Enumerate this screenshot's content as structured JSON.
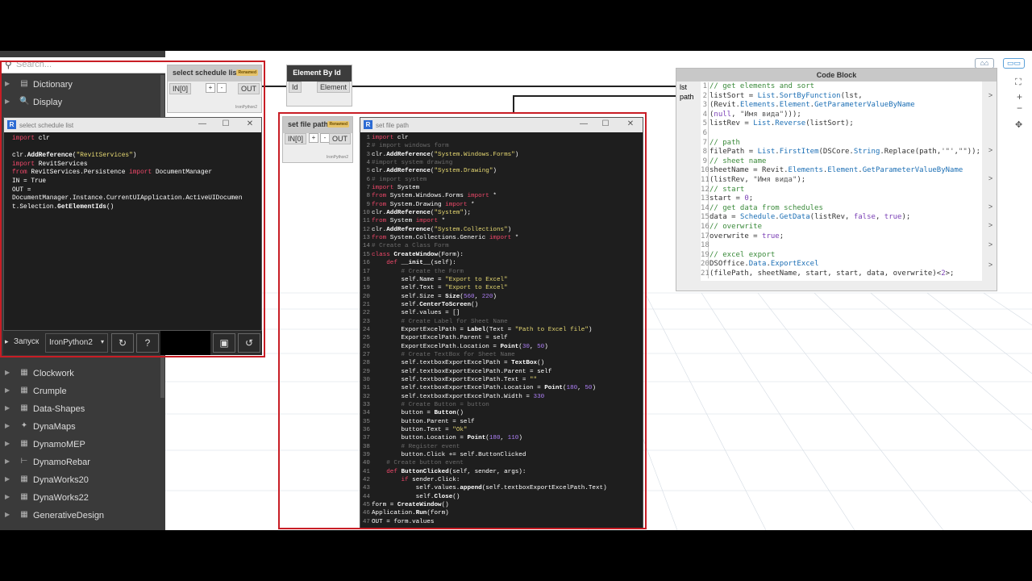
{
  "library": {
    "search_placeholder": "Search...",
    "items": [
      {
        "label": "Dictionary",
        "icon": "dictionary-icon",
        "glyph": "▤"
      },
      {
        "label": "Display",
        "icon": "display-icon",
        "glyph": "🔍"
      },
      {
        "label": "Clockwork",
        "icon": "package-icon",
        "glyph": "▦"
      },
      {
        "label": "Crumple",
        "icon": "package-icon",
        "glyph": "▦"
      },
      {
        "label": "Data-Shapes",
        "icon": "package-icon",
        "glyph": "▦"
      },
      {
        "label": "DynaMaps",
        "icon": "dynamaps-icon",
        "glyph": "✦"
      },
      {
        "label": "DynamoMEP",
        "icon": "package-icon",
        "glyph": "▦"
      },
      {
        "label": "DynamoRebar",
        "icon": "rebar-icon",
        "glyph": "⊢"
      },
      {
        "label": "DynaWorks20",
        "icon": "package-icon",
        "glyph": "▦"
      },
      {
        "label": "DynaWorks22",
        "icon": "package-icon",
        "glyph": "▦"
      },
      {
        "label": "GenerativeDesign",
        "icon": "package-icon",
        "glyph": "▦"
      }
    ]
  },
  "nodes": {
    "select_schedule": {
      "title": "select schedule list",
      "badge": "Renamed",
      "in": "IN[0]",
      "out": "OUT",
      "plus": "+",
      "minus": "-",
      "footer": "IronPython2"
    },
    "element_by_id": {
      "title": "Element By Id",
      "in": "Id",
      "out": "Element"
    },
    "set_file_path": {
      "title": "set file path",
      "badge": "Renamed",
      "in": "IN[0]",
      "out": "OUT",
      "plus": "+",
      "minus": "-",
      "footer": "IronPython2"
    },
    "code_block": {
      "title": "Code Block",
      "in1": "lst",
      "in2": "path",
      "out": ">"
    }
  },
  "window1": {
    "title": "select schedule list",
    "run_label": "Запуск",
    "engine": "IronPython2"
  },
  "window2": {
    "title": "set file path"
  },
  "colors": {
    "highlight": "#c81d25",
    "keyword": "#f0486a",
    "string": "#e7d972"
  }
}
